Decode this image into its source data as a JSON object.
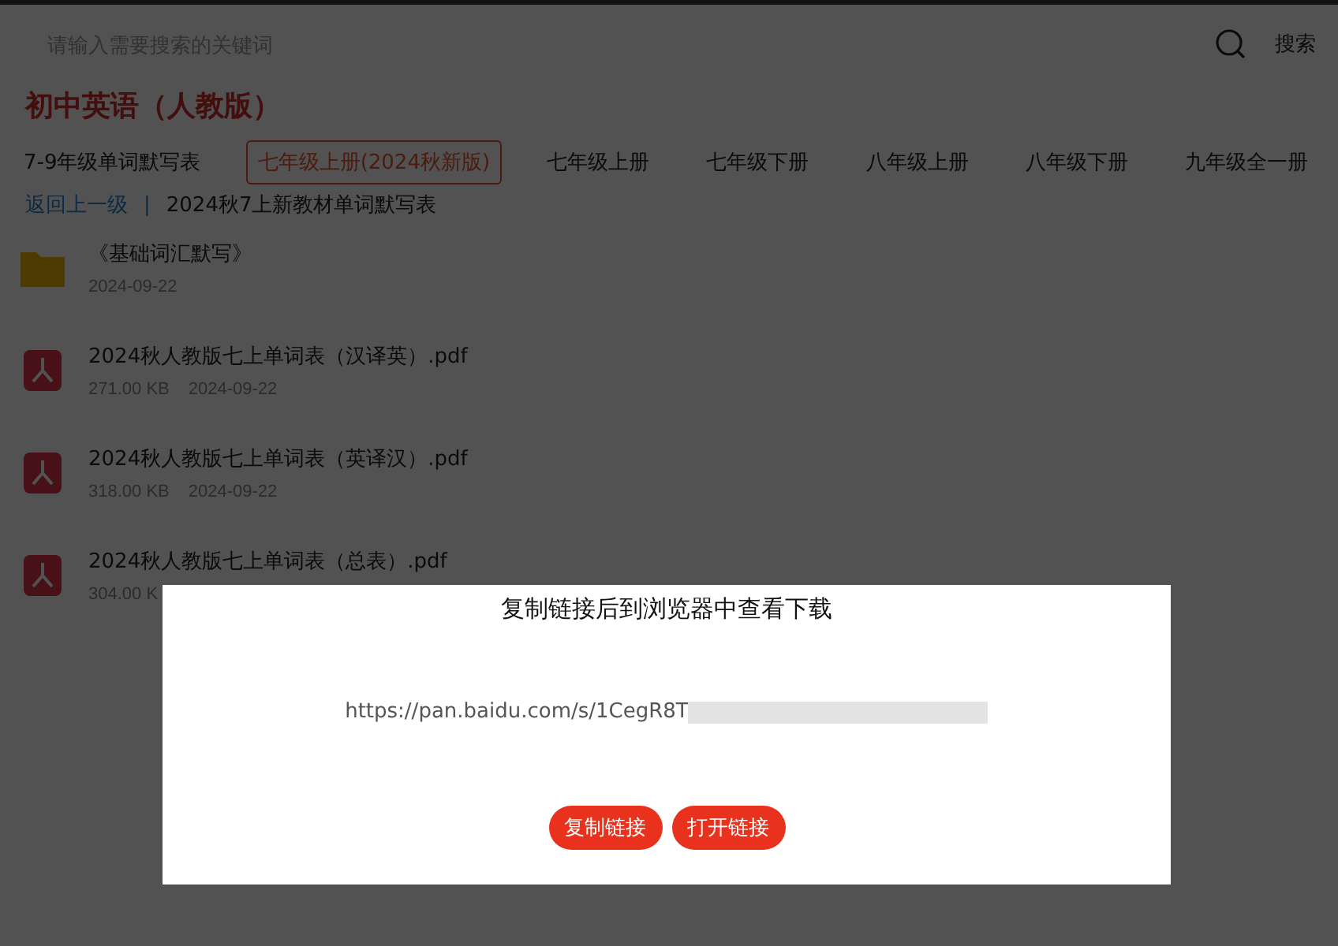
{
  "search": {
    "placeholder": "请输入需要搜索的关键词",
    "button": "搜索"
  },
  "title": "初中英语（人教版）",
  "tabs": [
    {
      "label": "7-9年级单词默写表",
      "selected": false
    },
    {
      "label": "七年级上册(2024秋新版)",
      "selected": true
    },
    {
      "label": "七年级上册",
      "selected": false
    },
    {
      "label": "七年级下册",
      "selected": false
    },
    {
      "label": "八年级上册",
      "selected": false
    },
    {
      "label": "八年级下册",
      "selected": false
    },
    {
      "label": "九年级全一册",
      "selected": false
    }
  ],
  "breadcrumb": {
    "back": "返回上一级",
    "separator": "|",
    "current": "2024秋7上新教材单词默写表"
  },
  "files": [
    {
      "kind": "folder",
      "name": "《基础词汇默写》",
      "date": "2024-09-22"
    },
    {
      "kind": "pdf",
      "name": "2024秋人教版七上单词表（汉译英）.pdf",
      "size": "271.00 KB",
      "date": "2024-09-22"
    },
    {
      "kind": "pdf",
      "name": "2024秋人教版七上单词表（英译汉）.pdf",
      "size": "318.00 KB",
      "date": "2024-09-22"
    },
    {
      "kind": "pdf",
      "name": "2024秋人教版七上单词表（总表）.pdf",
      "size": "304.00 K"
    }
  ],
  "dialog": {
    "title": "复制链接后到浏览器中查看下载",
    "link": "https://pan.baidu.com/s/1CegR8T",
    "buttons": [
      "复制链接",
      "打开链接"
    ]
  }
}
